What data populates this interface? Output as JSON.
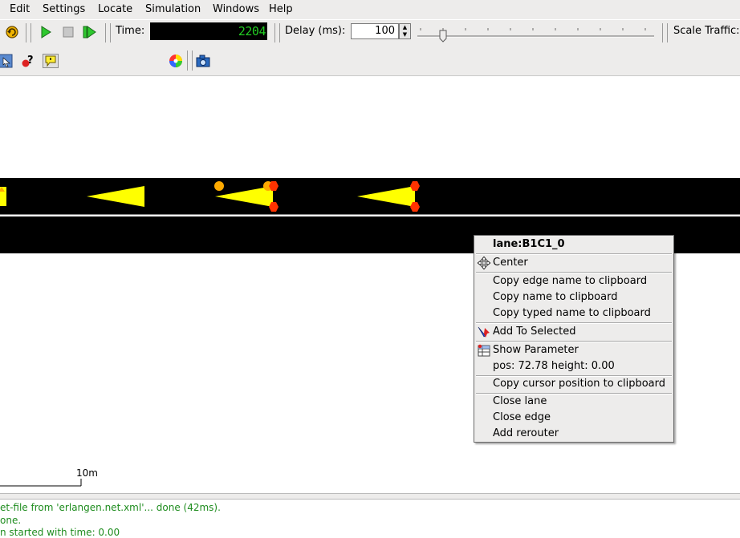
{
  "menubar": {
    "items": [
      "Edit",
      "Settings",
      "Locate",
      "Simulation",
      "Windows",
      "Help"
    ]
  },
  "toolbar": {
    "time_label": "Time:",
    "time_value": "2204",
    "delay_label": "Delay (ms):",
    "delay_value": "100",
    "scale_traffic_label": "Scale Traffic:",
    "scheme_value": "standard"
  },
  "canvas": {
    "scale_label": "10m"
  },
  "context_menu": {
    "title": "lane:B1C1_0",
    "items": {
      "center": "Center",
      "copy_edge_name": "Copy edge name to clipboard",
      "copy_name": "Copy name to clipboard",
      "copy_typed_name": "Copy typed name to clipboard",
      "add_to_selected": "Add To Selected",
      "show_parameter": "Show Parameter",
      "pos_info": "pos: 72.78 height: 0.00",
      "copy_cursor_pos": "Copy cursor position to clipboard",
      "close_lane": "Close lane",
      "close_edge": "Close edge",
      "add_rerouter": "Add rerouter"
    }
  },
  "log": {
    "lines": [
      "et-file from 'erlangen.net.xml'... done (42ms).",
      "one.",
      "n started with time: 0.00"
    ]
  },
  "colors": {
    "vehicle": "#ffff00",
    "lane": "#000000",
    "log_text": "#1e8c1e",
    "time_digits": "#22cc22",
    "brake_light": "#ff3300",
    "blinker": "#ffaa00"
  }
}
